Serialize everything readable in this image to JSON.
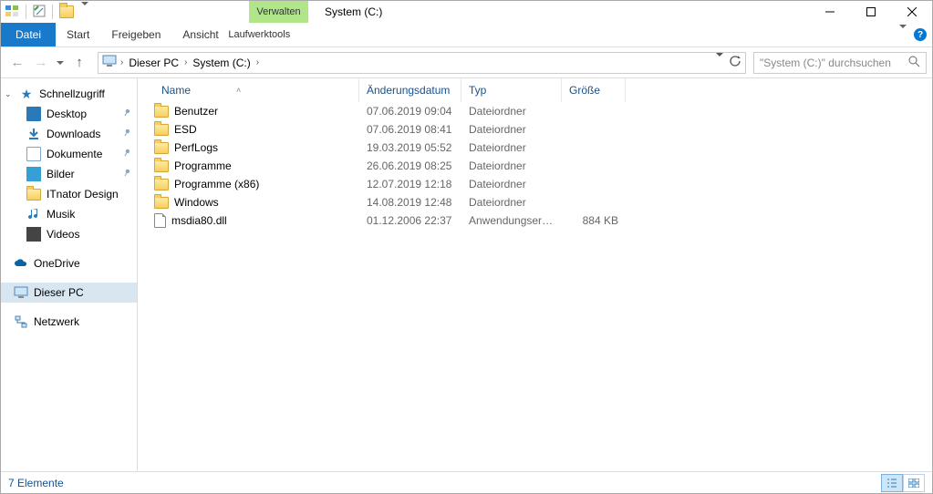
{
  "titlebar": {
    "contextual_label": "Verwalten",
    "window_title": "System (C:)"
  },
  "ribbon": {
    "file": "Datei",
    "tabs": [
      "Start",
      "Freigeben",
      "Ansicht"
    ],
    "tools_tab": "Laufwerktools"
  },
  "addressbar": {
    "segments": [
      "Dieser PC",
      "System (C:)"
    ]
  },
  "search": {
    "placeholder": "\"System (C:)\" durchsuchen"
  },
  "navpane": {
    "quick": {
      "label": "Schnellzugriff",
      "items": [
        {
          "label": "Desktop",
          "pinned": true,
          "icon": "desktop"
        },
        {
          "label": "Downloads",
          "pinned": true,
          "icon": "downloads"
        },
        {
          "label": "Dokumente",
          "pinned": true,
          "icon": "documents"
        },
        {
          "label": "Bilder",
          "pinned": true,
          "icon": "pictures"
        },
        {
          "label": "ITnator Design",
          "pinned": false,
          "icon": "folder"
        },
        {
          "label": "Musik",
          "pinned": false,
          "icon": "music"
        },
        {
          "label": "Videos",
          "pinned": false,
          "icon": "videos"
        }
      ]
    },
    "onedrive": "OneDrive",
    "this_pc": "Dieser PC",
    "network": "Netzwerk"
  },
  "columns": {
    "name": "Name",
    "date": "Änderungsdatum",
    "type": "Typ",
    "size": "Größe"
  },
  "rows": [
    {
      "name": "Benutzer",
      "date": "07.06.2019 09:04",
      "type": "Dateiordner",
      "size": "",
      "kind": "folder"
    },
    {
      "name": "ESD",
      "date": "07.06.2019 08:41",
      "type": "Dateiordner",
      "size": "",
      "kind": "folder"
    },
    {
      "name": "PerfLogs",
      "date": "19.03.2019 05:52",
      "type": "Dateiordner",
      "size": "",
      "kind": "folder"
    },
    {
      "name": "Programme",
      "date": "26.06.2019 08:25",
      "type": "Dateiordner",
      "size": "",
      "kind": "folder"
    },
    {
      "name": "Programme (x86)",
      "date": "12.07.2019 12:18",
      "type": "Dateiordner",
      "size": "",
      "kind": "folder"
    },
    {
      "name": "Windows",
      "date": "14.08.2019 12:48",
      "type": "Dateiordner",
      "size": "",
      "kind": "folder"
    },
    {
      "name": "msdia80.dll",
      "date": "01.12.2006 22:37",
      "type": "Anwendungserwe...",
      "size": "884 KB",
      "kind": "file"
    }
  ],
  "statusbar": {
    "item_count": "7 Elemente"
  }
}
